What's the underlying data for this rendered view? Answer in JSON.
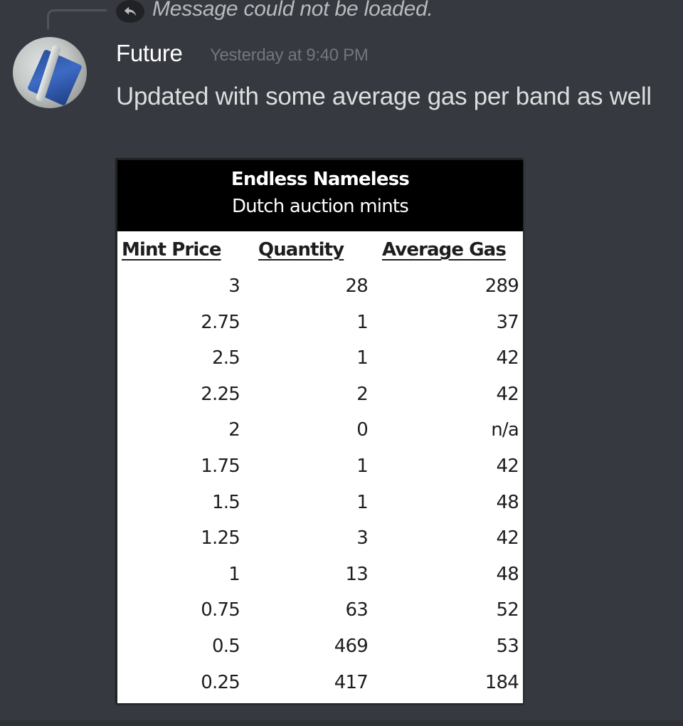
{
  "reply": {
    "icon": "reply-arrow-icon",
    "text": "Message could not be loaded."
  },
  "message": {
    "author": "Future",
    "avatar": "avatar-image",
    "timestamp": "Yesterday at 9:40 PM",
    "text": "Updated with some average gas per band as well"
  },
  "attachment": {
    "title": "Endless Nameless",
    "subtitle": "Dutch auction mints",
    "columns": [
      "Mint Price",
      "Quantity",
      "Average Gas"
    ],
    "rows": [
      [
        "3",
        "28",
        "289"
      ],
      [
        "2.75",
        "1",
        "37"
      ],
      [
        "2.5",
        "1",
        "42"
      ],
      [
        "2.25",
        "2",
        "42"
      ],
      [
        "2",
        "0",
        "n/a"
      ],
      [
        "1.75",
        "1",
        "42"
      ],
      [
        "1.5",
        "1",
        "48"
      ],
      [
        "1.25",
        "3",
        "42"
      ],
      [
        "1",
        "13",
        "48"
      ],
      [
        "0.75",
        "63",
        "52"
      ],
      [
        "0.5",
        "469",
        "53"
      ],
      [
        "0.25",
        "417",
        "184"
      ]
    ]
  },
  "colors": {
    "background": "#36393f",
    "username": "#ffffff",
    "timestamp": "#72767d",
    "message_text": "#dcddde",
    "reply_text": "#b9bbbe"
  }
}
